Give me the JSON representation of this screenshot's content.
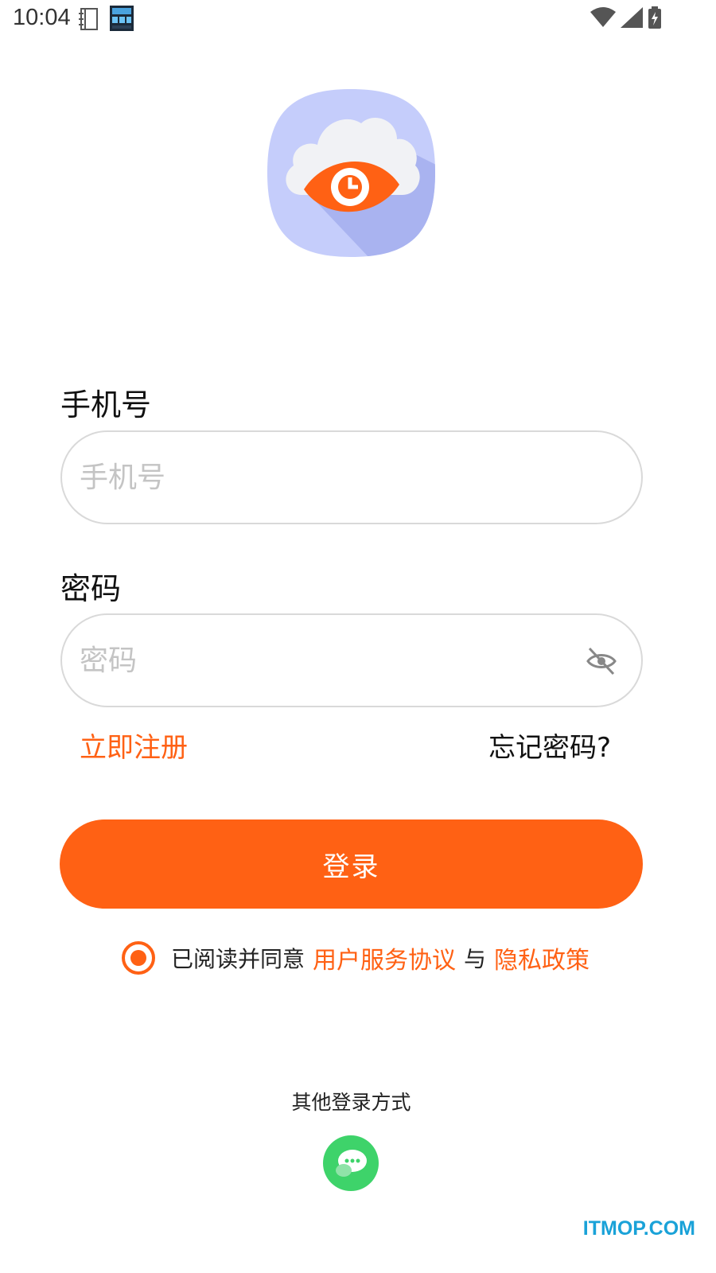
{
  "status_bar": {
    "time": "10:04",
    "icons": [
      "notebook-icon",
      "clock-app-icon",
      "wifi-icon",
      "signal-icon",
      "battery-charging-icon"
    ]
  },
  "logo": {
    "icon": "cloud-eye-logo-icon"
  },
  "form": {
    "phone_label": "手机号",
    "phone_placeholder": "手机号",
    "phone_value": "",
    "password_label": "密码",
    "password_placeholder": "密码",
    "password_value": ""
  },
  "links": {
    "register": "立即注册",
    "forgot": "忘记密码?"
  },
  "login_button": "登录",
  "agreement": {
    "prefix": "已阅读并同意",
    "terms": "用户服务协议",
    "and": "与",
    "privacy": "隐私政策",
    "checked": true
  },
  "other_login": {
    "label": "其他登录方式",
    "icon": "wechat-icon"
  },
  "watermark": "ITMOP.COM",
  "colors": {
    "accent": "#ff6114",
    "wechat": "#3ed36a",
    "logo_bg": "#c5cdfb"
  }
}
